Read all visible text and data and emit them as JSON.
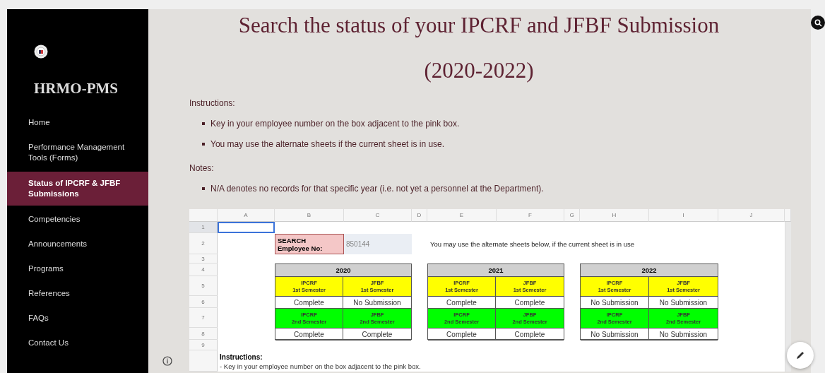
{
  "sidebar": {
    "site_title": "HRMO-PMS",
    "items": [
      {
        "label": "Home",
        "selected": false
      },
      {
        "label": "Performance Management Tools (Forms)",
        "selected": false
      },
      {
        "label": "Status of IPCRF & JFBF Submissions",
        "selected": true
      },
      {
        "label": "Competencies",
        "selected": false
      },
      {
        "label": "Announcements",
        "selected": false
      },
      {
        "label": "Programs",
        "selected": false
      },
      {
        "label": "References",
        "selected": false
      },
      {
        "label": "FAQs",
        "selected": false
      },
      {
        "label": "Contact Us",
        "selected": false
      }
    ]
  },
  "page": {
    "title_lines": [
      "Search the status of your IPCRF and JFBF Submission",
      "(2020-2022)"
    ],
    "instructions_heading": "Instructions:",
    "instructions": [
      "Key in your employee number on the box adjacent to the pink box.",
      "You may use the alternate sheets if the current sheet is in use."
    ],
    "notes_heading": "Notes:",
    "notes": [
      "N/A denotes no records for that specific year (i.e. not yet a personnel at the Department)."
    ]
  },
  "sheet": {
    "columns": [
      "A",
      "B",
      "C",
      "D",
      "E",
      "F",
      "G",
      "H",
      "I",
      "J"
    ],
    "rows": [
      {
        "label": "1",
        "selected": true
      },
      {
        "label": "2",
        "selected": false
      },
      {
        "label": "3",
        "selected": false
      },
      {
        "label": "4",
        "selected": false
      },
      {
        "label": "5",
        "selected": false
      },
      {
        "label": "6",
        "selected": false
      },
      {
        "label": "7",
        "selected": false
      },
      {
        "label": "8",
        "selected": false
      },
      {
        "label": "9",
        "selected": false
      }
    ],
    "search_label": "SEARCH\nEmployee No:",
    "employee_no": "850144",
    "note": "You may use the alternate sheets below, if the current sheet is in use",
    "years": [
      {
        "year": "2020",
        "rows": [
          {
            "kind": "first",
            "headers": [
              {
                "form": "IPCRF",
                "semester": "1st Semester"
              },
              {
                "form": "JFBF",
                "semester": "1st Semester"
              }
            ],
            "statuses": [
              "Complete",
              "No Submission"
            ]
          },
          {
            "kind": "second",
            "headers": [
              {
                "form": "IPCRF",
                "semester": "2nd Semester"
              },
              {
                "form": "JFBF",
                "semester": "2nd Semester"
              }
            ],
            "statuses": [
              "Complete",
              "Complete"
            ]
          }
        ]
      },
      {
        "year": "2021",
        "rows": [
          {
            "kind": "first",
            "headers": [
              {
                "form": "IPCRF",
                "semester": "1st Semester"
              },
              {
                "form": "JFBF",
                "semester": "1st Semester"
              }
            ],
            "statuses": [
              "Complete",
              "Complete"
            ]
          },
          {
            "kind": "second",
            "headers": [
              {
                "form": "IPCRF",
                "semester": "2nd Semester"
              },
              {
                "form": "JFBF",
                "semester": "2nd Semester"
              }
            ],
            "statuses": [
              "Complete",
              "Complete"
            ]
          }
        ]
      },
      {
        "year": "2022",
        "rows": [
          {
            "kind": "first",
            "headers": [
              {
                "form": "IPCRF",
                "semester": "1st Semester"
              },
              {
                "form": "JFBF",
                "semester": "1st Semester"
              }
            ],
            "statuses": [
              "No Submission",
              "No Submission"
            ]
          },
          {
            "kind": "second",
            "headers": [
              {
                "form": "IPCRF",
                "semester": "2nd Semester"
              },
              {
                "form": "JFBF",
                "semester": "2nd Semester"
              }
            ],
            "statuses": [
              "No Submission",
              "No Submission"
            ]
          }
        ]
      }
    ],
    "instructions_heading": "Instructions:",
    "instructions_line": "- Key in your employee number on the box adjacent to the pink box."
  }
}
